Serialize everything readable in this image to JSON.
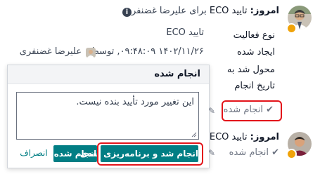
{
  "activity_top": {
    "label": "امروز:",
    "title": "تایید ECO",
    "assigned": "برای علیرضا غضنفری",
    "info_icon": "info-circle-icon"
  },
  "details": {
    "type_label": "نوع فعالیت",
    "type_value": "تایید ECO",
    "created_label": "ایجاد شده",
    "created_value": "۱۴۰۲/۱۱/۲۶ ۰۹:۴۸:۰۹, توسط",
    "created_by": "علیرضا غضنفری",
    "assigned_label": "محول شد به",
    "date_label": "تاریخ انجام"
  },
  "popover": {
    "title": "انجام شده",
    "feedback": "این تغییر مورد تأیید بنده نیست."
  },
  "buttons": {
    "done_schedule": "انجام شد و برنامه‌ریزی بعدی",
    "done": "انجام شده",
    "discard": "انصراف"
  },
  "mark_done": {
    "label": "انجام شده",
    "icon": "check-icon"
  },
  "activity_bottom": {
    "label": "امروز:",
    "title": "تایید ECO",
    "done_label": "انجام شده"
  },
  "colors": {
    "primary": "#017e84",
    "highlight": "#e3141a",
    "status": "#f0a30a"
  }
}
